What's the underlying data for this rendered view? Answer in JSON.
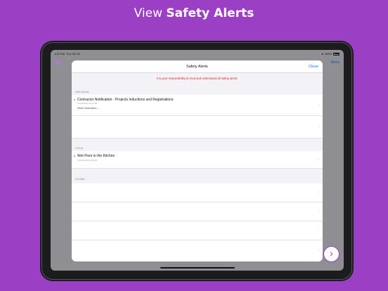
{
  "headline": {
    "prefix": "View",
    "bold": "Safety Alerts"
  },
  "status_bar": {
    "time": "1:42 PM",
    "date": "Tue Oct 29",
    "battery": "100%"
  },
  "background_nav": {
    "menu_label": "Menu"
  },
  "modal": {
    "title": "Safety Alerts",
    "close_label": "Close",
    "notice": "It is your responsibility to read and understand all safety alerts."
  },
  "sections": {
    "individual": {
      "header": "INDIVIDUAL",
      "items": [
        {
          "title": "Contractor Notification -  Projects Inductions and Registrations",
          "time": "10/11/2019 12:13 AM",
          "preview": "Dear Contractor,..."
        }
      ]
    },
    "local": {
      "header": "LOCAL",
      "items": [
        {
          "title": "Wet Floor in the Kitchen",
          "time": "10/11/2019 11:18 AM"
        }
      ]
    },
    "global": {
      "header": "GLOBAL"
    }
  },
  "icons": {
    "chevron": "chevron-right-icon",
    "unread": "unread-dot-icon",
    "fab": "arrow-right-circle-icon",
    "nav": "app-logo-icon"
  },
  "colors": {
    "background": "#9b3fc4",
    "accent": "#1a73e8",
    "notice": "#e0281f"
  }
}
